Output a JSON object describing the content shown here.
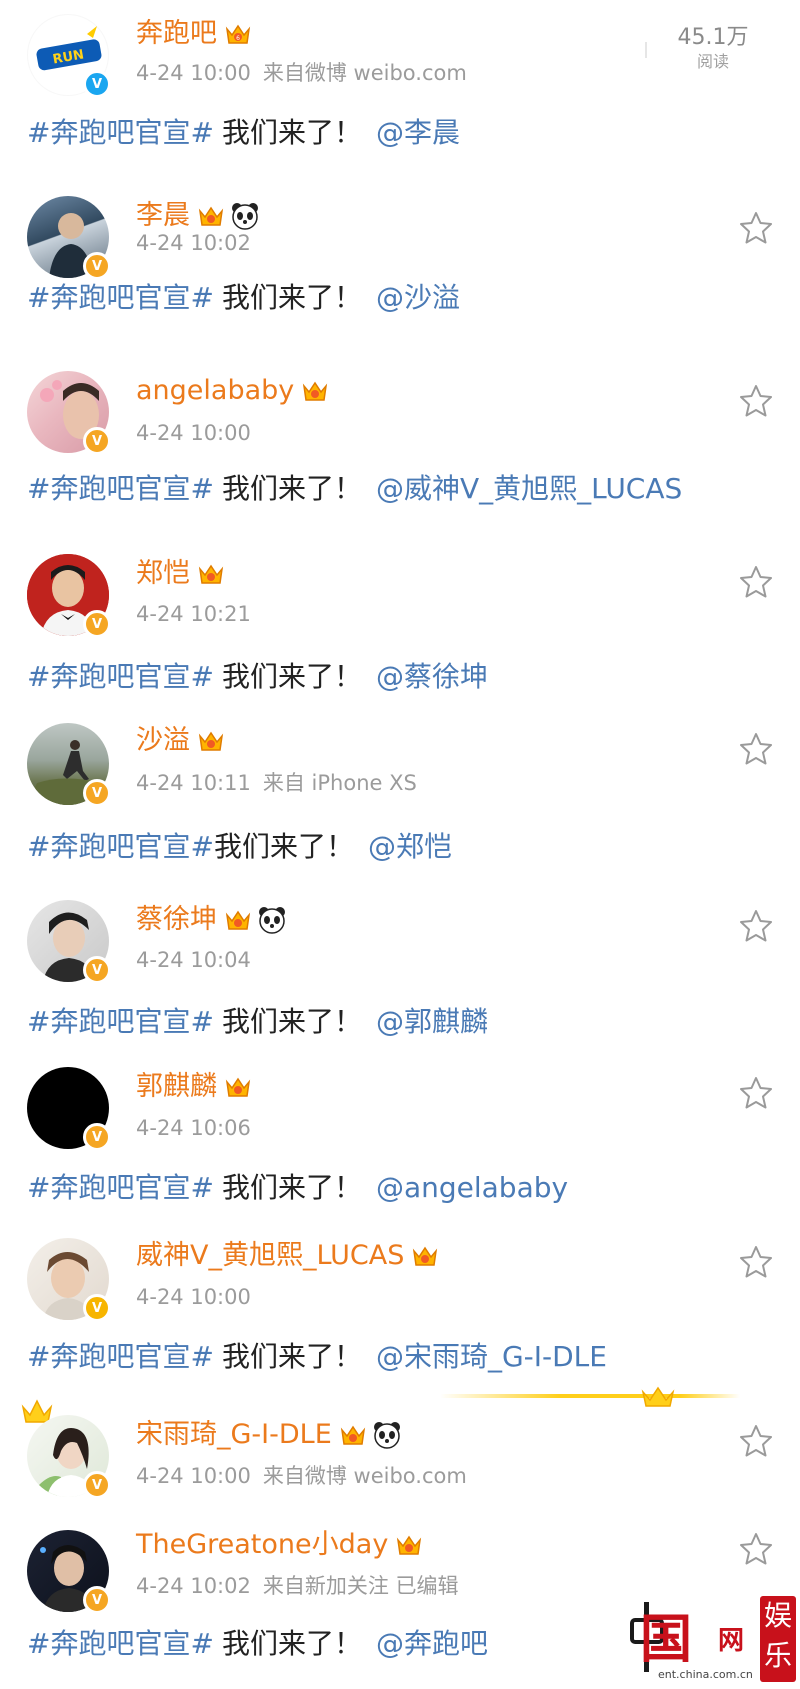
{
  "stats": {
    "read_count": "45.1万",
    "read_label": "阅读"
  },
  "posts": [
    {
      "name": "奔跑吧",
      "time": "4-24 10:00",
      "source": "来自微博 weibo.com",
      "hashtag": "#奔跑吧官宣#",
      "text": "我们来了！",
      "mention": "@李晨"
    },
    {
      "name": "李晨",
      "time": "4-24 10:02",
      "source": "",
      "hashtag": "#奔跑吧官宣#",
      "text": "我们来了！",
      "mention": "@沙溢"
    },
    {
      "name": "angelababy",
      "time": "4-24 10:00",
      "source": "",
      "hashtag": "#奔跑吧官宣#",
      "text": "我们来了！",
      "mention": "@威神V_黄旭熙_LUCAS"
    },
    {
      "name": "郑恺",
      "time": "4-24 10:21",
      "source": "",
      "hashtag": "#奔跑吧官宣#",
      "text": "我们来了！",
      "mention": "@蔡徐坤"
    },
    {
      "name": "沙溢",
      "time": "4-24 10:11",
      "source": "来自 iPhone XS",
      "hashtag": "#奔跑吧官宣#",
      "text": "我们来了！",
      "mention": "@郑恺"
    },
    {
      "name": "蔡徐坤",
      "time": "4-24 10:04",
      "source": "",
      "hashtag": "#奔跑吧官宣#",
      "text": "我们来了！",
      "mention": "@郭麒麟"
    },
    {
      "name": "郭麒麟",
      "time": "4-24 10:06",
      "source": "",
      "hashtag": "#奔跑吧官宣#",
      "text": "我们来了！",
      "mention": "@angelababy"
    },
    {
      "name": "威神V_黄旭熙_LUCAS",
      "time": "4-24 10:00",
      "source": "",
      "hashtag": "#奔跑吧官宣#",
      "text": "我们来了！",
      "mention": "@宋雨琦_G-I-DLE"
    },
    {
      "name": "宋雨琦_G-I-DLE",
      "time": "4-24 10:00",
      "source": "来自微博 weibo.com",
      "hashtag": "",
      "text": "",
      "mention": ""
    },
    {
      "name": "TheGreatone小day",
      "time": "4-24 10:02",
      "source": "来自新加关注  已编辑",
      "hashtag": "#奔跑吧官宣#",
      "text": "我们来了！",
      "mention": "@奔跑吧"
    }
  ],
  "watermark": {
    "box_text": "娱乐",
    "char_guo": "国",
    "char_wang": "网",
    "url": "ent.china.com.cn"
  },
  "colors": {
    "name": "#eb7a1c",
    "link": "#4a7ab5",
    "meta": "#9b9b9b",
    "badge_orange": "#f5a623",
    "badge_blue": "#1aa6f0",
    "brand_red": "#c8111b"
  },
  "icons": [
    "star-icon",
    "crown-icon",
    "panda-icon",
    "verified-badge-icon"
  ]
}
